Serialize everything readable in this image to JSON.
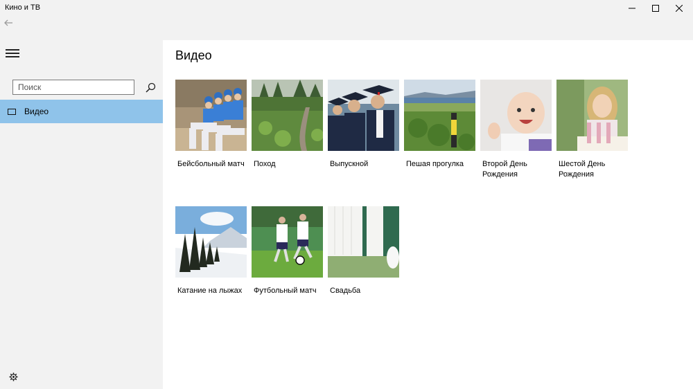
{
  "window": {
    "title": "Кино и ТВ"
  },
  "sidebar": {
    "search_placeholder": "Поиск",
    "nav_items": [
      {
        "label": "Видео",
        "selected": true
      }
    ]
  },
  "main": {
    "title": "Видео",
    "videos": [
      {
        "title": "Бейсбольный матч"
      },
      {
        "title": "Поход"
      },
      {
        "title": "Выпускной"
      },
      {
        "title": "Пешая прогулка"
      },
      {
        "title": "Второй День Рождения"
      },
      {
        "title": "Шестой День Рождения"
      },
      {
        "title": "Катание на лыжах"
      },
      {
        "title": "Футбольный матч"
      },
      {
        "title": "Свадьба"
      }
    ]
  },
  "colors": {
    "accent_selected": "#8fc3ea",
    "chrome_bg": "#f2f2f2",
    "content_bg": "#ffffff"
  }
}
